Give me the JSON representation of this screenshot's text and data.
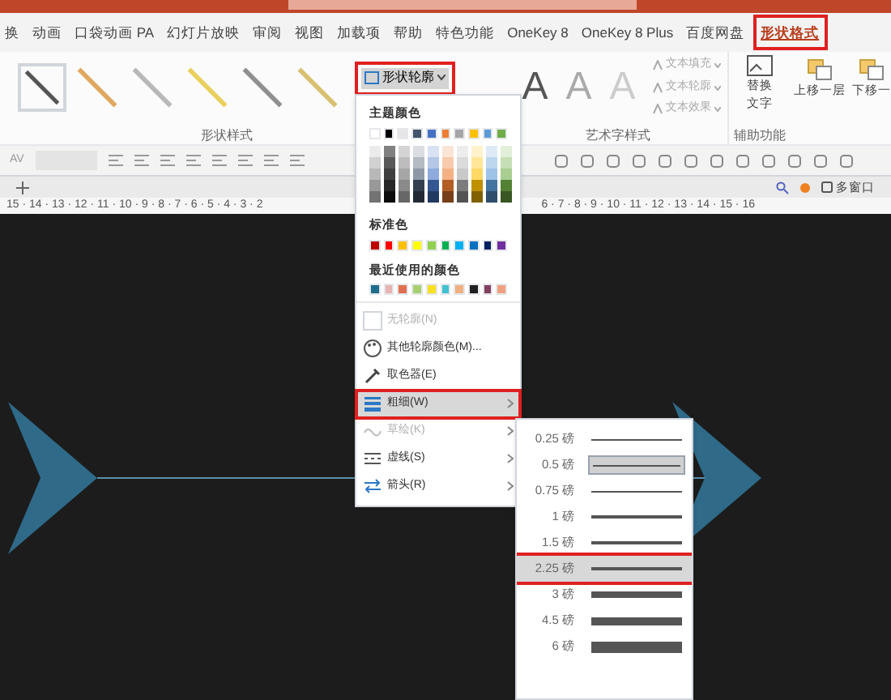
{
  "tabs": [
    {
      "label": "换",
      "selected": false
    },
    {
      "label": "动画",
      "selected": false
    },
    {
      "label": "口袋动画 PA",
      "selected": false
    },
    {
      "label": "幻灯片放映",
      "selected": false
    },
    {
      "label": "审阅",
      "selected": false
    },
    {
      "label": "视图",
      "selected": false
    },
    {
      "label": "加载项",
      "selected": false
    },
    {
      "label": "帮助",
      "selected": false
    },
    {
      "label": "特色功能",
      "selected": false
    },
    {
      "label": "OneKey 8",
      "selected": false
    },
    {
      "label": "OneKey 8 Plus",
      "selected": false
    },
    {
      "label": "百度网盘",
      "selected": false
    },
    {
      "label": "形状格式",
      "selected": true
    }
  ],
  "ribbon": {
    "shape_styles": [
      {
        "color": "#555555",
        "selected": true
      },
      {
        "color": "#e0a860",
        "selected": false
      },
      {
        "color": "#b8b8b8",
        "selected": false
      },
      {
        "color": "#e8d060",
        "selected": false
      },
      {
        "color": "#909090",
        "selected": false
      },
      {
        "color": "#d8c070",
        "selected": false
      }
    ],
    "outline_button": "形状轮廓",
    "wordart_samples": [
      "A",
      "A",
      "A"
    ],
    "char_spacing": "AV",
    "text_options": [
      "文本填充",
      "文本轮廓",
      "文本效果"
    ],
    "alt_text": [
      "替换",
      "文字"
    ],
    "bring_forward": "上移一层",
    "send_backward": "下移一",
    "group_labels": [
      "形状样式",
      "艺术字样式",
      "辅助功能"
    ]
  },
  "window_button": "多窗口",
  "ruler": {
    "left": "15 · 14 · 13 · 12 · 11 · 10 · 9 · 8 · 7 · 6 · 5 · 4 · 3 · 2",
    "right": "6 · 7 · 8 · 9 · 10 · 11 · 12 · 13 · 14 · 15 · 16"
  },
  "outline_menu": {
    "theme_header": "主题颜色",
    "theme_colors": [
      {
        "color": "#ffffff"
      },
      {
        "color": "#000000"
      },
      {
        "color": "#e7e6e6"
      },
      {
        "color": "#44546a"
      },
      {
        "color": "#4472c4"
      },
      {
        "color": "#ed7d31"
      },
      {
        "color": "#a5a5a5"
      },
      {
        "color": "#ffc000"
      },
      {
        "color": "#5b9bd5"
      },
      {
        "color": "#70ad47"
      }
    ],
    "standard_header": "标准色",
    "standard_colors": [
      {
        "color": "#c00000"
      },
      {
        "color": "#ff0000"
      },
      {
        "color": "#ffc000"
      },
      {
        "color": "#ffff00"
      },
      {
        "color": "#92d050"
      },
      {
        "color": "#00b050"
      },
      {
        "color": "#00b0f0"
      },
      {
        "color": "#0070c0"
      },
      {
        "color": "#002060"
      },
      {
        "color": "#7030a0"
      }
    ],
    "recent_header": "最近使用的颜色",
    "recent_colors": [
      {
        "color": "#1f6e8c"
      },
      {
        "color": "#e8b4b0"
      },
      {
        "color": "#e07050"
      },
      {
        "color": "#a8d070"
      },
      {
        "color": "#f8e020"
      },
      {
        "color": "#40c0d0"
      },
      {
        "color": "#f0b080"
      },
      {
        "color": "#202020"
      },
      {
        "color": "#804060"
      },
      {
        "color": "#f0a080"
      }
    ],
    "items": [
      {
        "kind": "no-outline",
        "label": "无轮廓(N)",
        "disabled": true,
        "selected": false,
        "submenu": false
      },
      {
        "kind": "more-colors",
        "label": "其他轮廓颜色(M)...",
        "disabled": false,
        "selected": false,
        "submenu": false
      },
      {
        "kind": "eyedropper",
        "label": "取色器(E)",
        "disabled": false,
        "selected": false,
        "submenu": false
      },
      {
        "kind": "weight",
        "label": "粗细(W)",
        "disabled": false,
        "selected": true,
        "submenu": true
      },
      {
        "kind": "sketch",
        "label": "草绘(K)",
        "disabled": true,
        "selected": false,
        "submenu": true
      },
      {
        "kind": "dashes",
        "label": "虚线(S)",
        "disabled": false,
        "selected": false,
        "submenu": true
      },
      {
        "kind": "arrows",
        "label": "箭头(R)",
        "disabled": false,
        "selected": false,
        "submenu": true
      }
    ]
  },
  "weight_menu": [
    {
      "label": "0.25 磅",
      "checked": false,
      "selected": false
    },
    {
      "label": "0.5 磅",
      "checked": true,
      "selected": false
    },
    {
      "label": "0.75 磅",
      "checked": false,
      "selected": false
    },
    {
      "label": "1 磅",
      "checked": false,
      "selected": false
    },
    {
      "label": "1.5 磅",
      "checked": false,
      "selected": false
    },
    {
      "label": "2.25 磅",
      "checked": false,
      "selected": true
    },
    {
      "label": "3 磅",
      "checked": false,
      "selected": false
    },
    {
      "label": "4.5 磅",
      "checked": false,
      "selected": false
    },
    {
      "label": "6 磅",
      "checked": false,
      "selected": false
    }
  ]
}
